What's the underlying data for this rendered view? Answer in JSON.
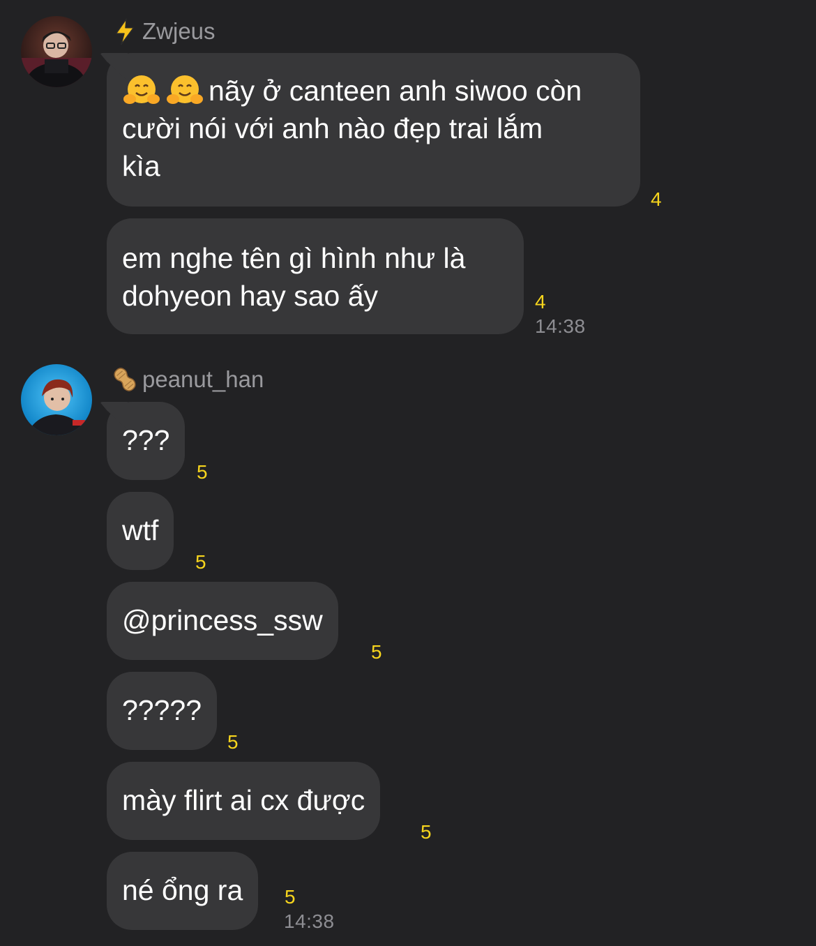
{
  "group1": {
    "sender": "Zwjeus",
    "sender_icon": "lightning-icon",
    "avatar": "avatar-zwjeus",
    "messages": [
      {
        "line1": "nãy ở canteen anh siwoo còn",
        "line2": "cười nói với anh nào đẹp trai lắm",
        "line3": "kìa",
        "emojis": [
          "hugging-face-icon",
          "hugging-face-icon"
        ],
        "count": "4"
      },
      {
        "line1": "em nghe tên gì hình như là",
        "line2": "dohyeon hay sao ấy",
        "count": "4",
        "time": "14:38"
      }
    ]
  },
  "group2": {
    "sender": "peanut_han",
    "sender_icon": "peanut-icon",
    "avatar": "avatar-peanut-han",
    "messages": [
      {
        "text": "???",
        "count": "5"
      },
      {
        "text": "wtf",
        "count": "5"
      },
      {
        "text": "@princess_ssw",
        "count": "5"
      },
      {
        "text": "?????",
        "count": "5"
      },
      {
        "text": "mày flirt ai cx được",
        "count": "5"
      },
      {
        "text": "né ổng ra",
        "count": "5",
        "time": "14:38"
      }
    ]
  },
  "colors": {
    "background": "#222224",
    "bubble": "#373739",
    "count": "#f7d51d",
    "meta": "#8e8e93"
  }
}
